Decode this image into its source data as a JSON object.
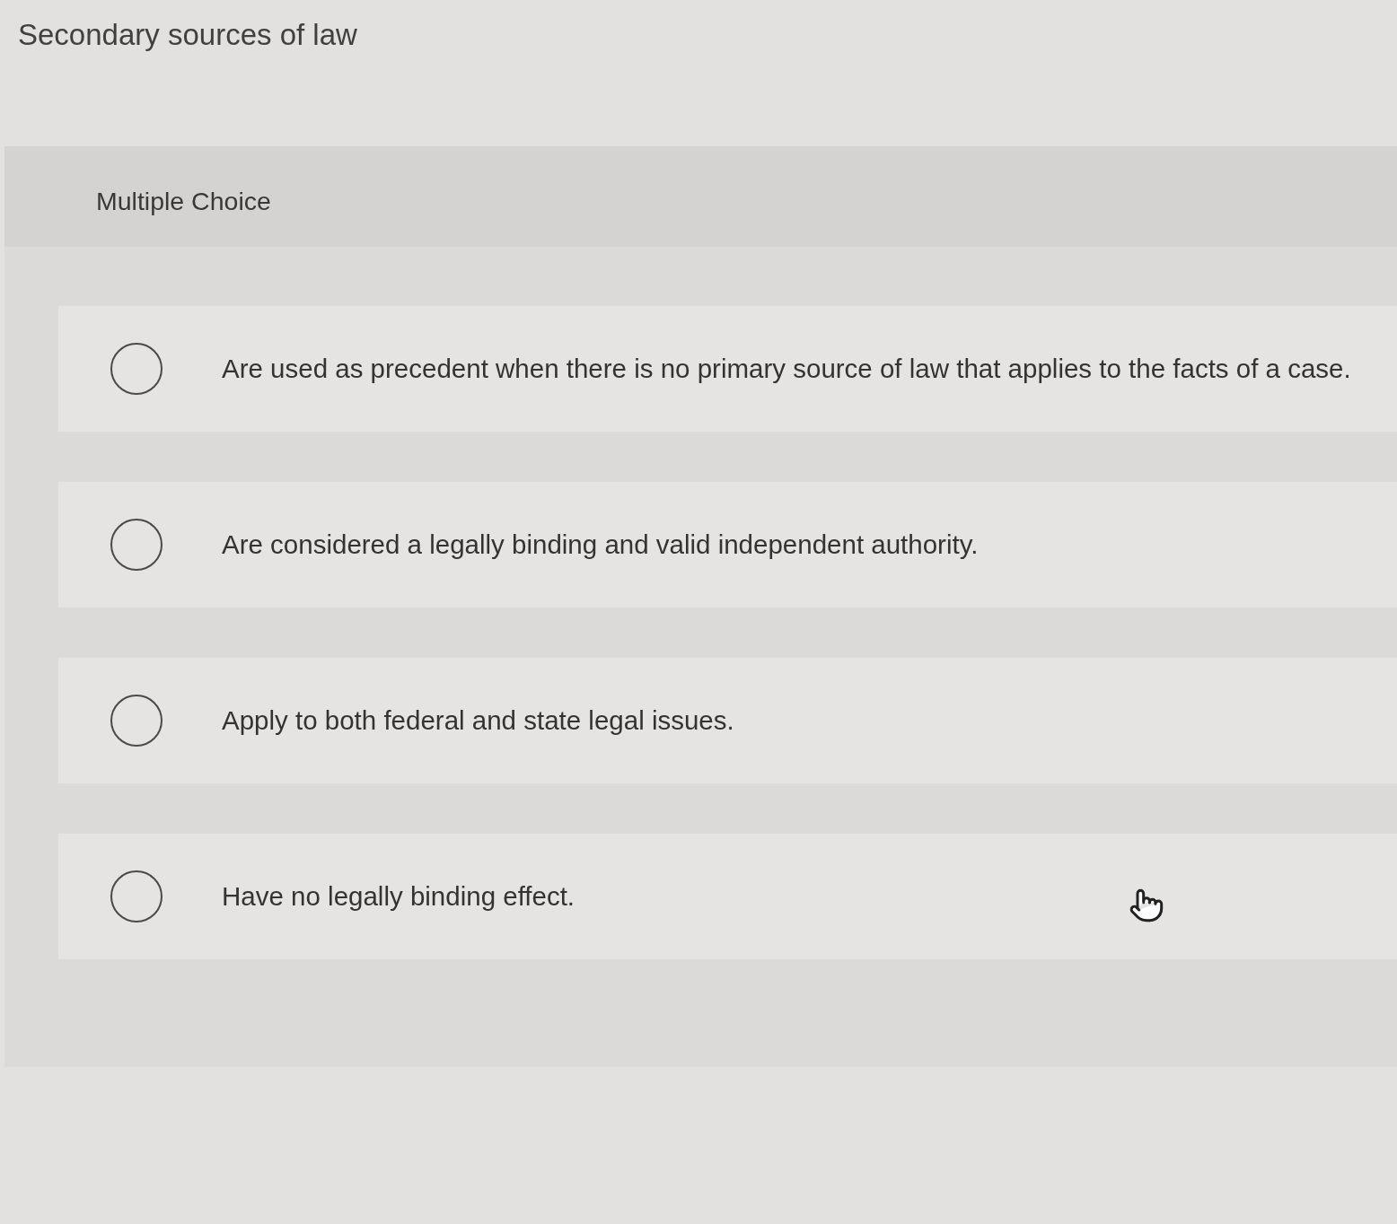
{
  "title": "Secondary sources of law",
  "question": {
    "type_label": "Multiple Choice",
    "options": [
      {
        "text": "Are used as precedent when there is no primary source of law that applies to the facts of a case.",
        "selected": false
      },
      {
        "text": "Are considered a legally binding and valid independent authority.",
        "selected": false
      },
      {
        "text": "Apply to both federal and state legal issues.",
        "selected": false
      },
      {
        "text": "Have no legally binding effect.",
        "selected": false
      }
    ]
  }
}
